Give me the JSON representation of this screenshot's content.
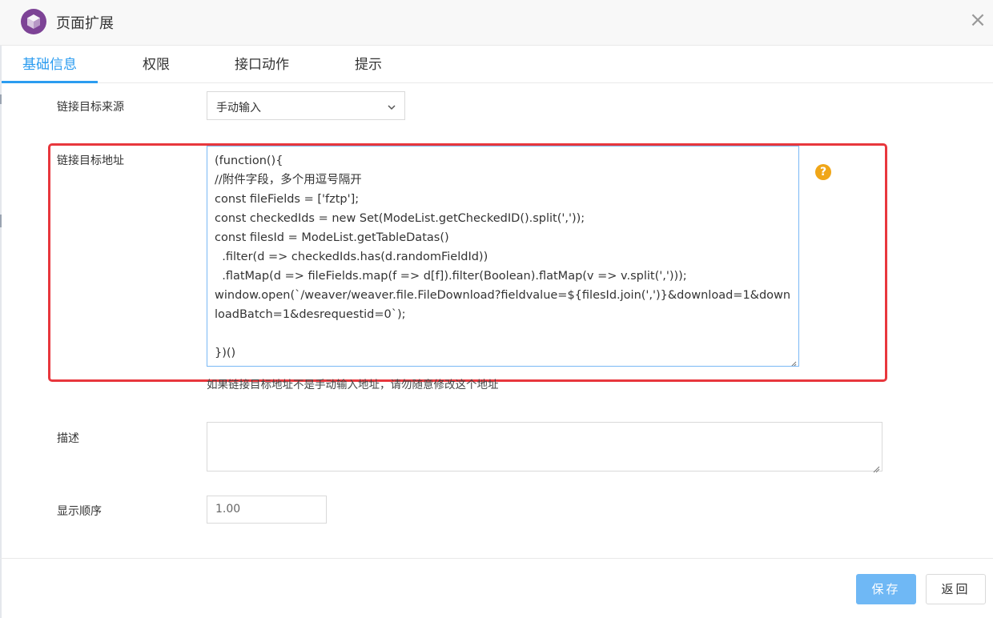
{
  "dialog": {
    "title": "页面扩展",
    "icon": "cube-logo-icon",
    "accent": "#2b9cf0",
    "close_glyph": "×"
  },
  "tabs": [
    {
      "label": "基础信息",
      "active": true
    },
    {
      "label": "权限",
      "active": false
    },
    {
      "label": "接口动作",
      "active": false
    },
    {
      "label": "提示",
      "active": false
    }
  ],
  "form": {
    "link_source": {
      "label": "链接目标来源",
      "value": "手动输入"
    },
    "link_address": {
      "label": "链接目标地址",
      "value": "(function(){\n//附件字段，多个用逗号隔开\nconst fileFields = ['fztp'];\nconst checkedIds = new Set(ModeList.getCheckedID().split(','));\nconst filesId = ModeList.getTableDatas()\n  .filter(d => checkedIds.has(d.randomFieldId))\n  .flatMap(d => fileFields.map(f => d[f]).filter(Boolean).flatMap(v => v.split(',')));\nwindow.open(`/weaver/weaver.file.FileDownload?fieldvalue=${filesId.join(',')}&download=1&downloadBatch=1&desrequestid=0`);\n\n})()",
      "hint": "如果链接目标地址不是手动输入地址，请勿随意修改这个地址",
      "help_glyph": "?"
    },
    "description": {
      "label": "描述",
      "value": ""
    },
    "display_order": {
      "label": "显示顺序",
      "value": "1.00"
    }
  },
  "footer": {
    "save_label": "保存",
    "back_label": "返回"
  },
  "colors": {
    "highlight_border": "#e8373d",
    "help_icon": "#f0a618",
    "save_button": "#6fb8f5",
    "logo": "#7d4396"
  }
}
